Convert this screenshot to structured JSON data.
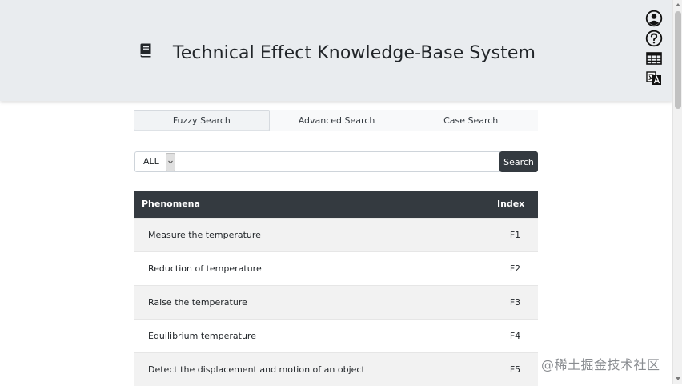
{
  "header": {
    "title": "Technical Effect Knowledge-Base System",
    "book_icon": "book-icon",
    "icons": [
      "user-circle-icon",
      "question-circle-icon",
      "table-icon",
      "translate-icon"
    ]
  },
  "tabs": [
    {
      "label": "Fuzzy Search",
      "active": true
    },
    {
      "label": "Advanced Search",
      "active": false
    },
    {
      "label": "Case Search",
      "active": false
    }
  ],
  "search": {
    "scope_value": "ALL",
    "query": "",
    "button_label": "Search"
  },
  "table": {
    "columns": [
      "Phenomena",
      "Index"
    ],
    "rows": [
      {
        "phenomena": "Measure the temperature",
        "index": "F1"
      },
      {
        "phenomena": "Reduction of temperature",
        "index": "F2"
      },
      {
        "phenomena": "Raise the temperature",
        "index": "F3"
      },
      {
        "phenomena": "Equilibrium temperature",
        "index": "F4"
      },
      {
        "phenomena": "Detect the displacement and motion of an object",
        "index": "F5"
      }
    ]
  },
  "watermark": "@稀土掘金技术社区",
  "colors": {
    "header_bg": "#e9ecef",
    "dark": "#343a40",
    "row_stripe": "#f2f2f2"
  }
}
